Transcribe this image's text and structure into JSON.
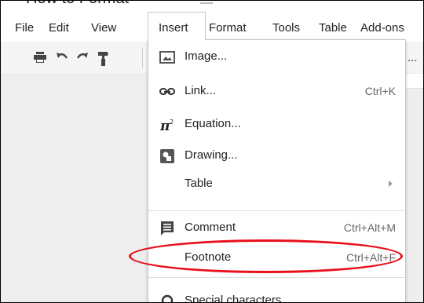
{
  "document": {
    "title": "How to Format"
  },
  "menubar": {
    "items": [
      "File",
      "Edit",
      "View",
      "Insert",
      "Format",
      "Tools",
      "Table",
      "Add-ons"
    ],
    "active": "Insert"
  },
  "toolbar": {
    "print_icon": "print-icon",
    "undo_icon": "undo-icon",
    "redo_icon": "redo-icon",
    "paint_format_icon": "paint-format-icon",
    "overflow": "..."
  },
  "insert_menu": {
    "items": [
      {
        "label": "Image...",
        "icon": "image-icon",
        "shortcut": ""
      },
      {
        "label": "Link...",
        "icon": "link-icon",
        "shortcut": "Ctrl+K"
      },
      {
        "label": "Equation...",
        "icon": "equation-icon",
        "shortcut": ""
      },
      {
        "label": "Drawing...",
        "icon": "drawing-icon",
        "shortcut": ""
      },
      {
        "label": "Table",
        "icon": "",
        "shortcut": ""
      },
      {
        "label": "Comment",
        "icon": "comment-icon",
        "shortcut": "Ctrl+Alt+M"
      },
      {
        "label": "Footnote",
        "icon": "",
        "shortcut": "Ctrl+Alt+F"
      },
      {
        "label": "Special characters",
        "icon": "special-characters-icon",
        "shortcut": ""
      }
    ]
  },
  "annotation": {
    "highlighted_item": "Footnote",
    "color": "#e8101b"
  },
  "colors": {
    "accent": "#e8101b",
    "toolbar_bg": "#f5f5f5",
    "canvas_bg": "#eeeeee"
  }
}
